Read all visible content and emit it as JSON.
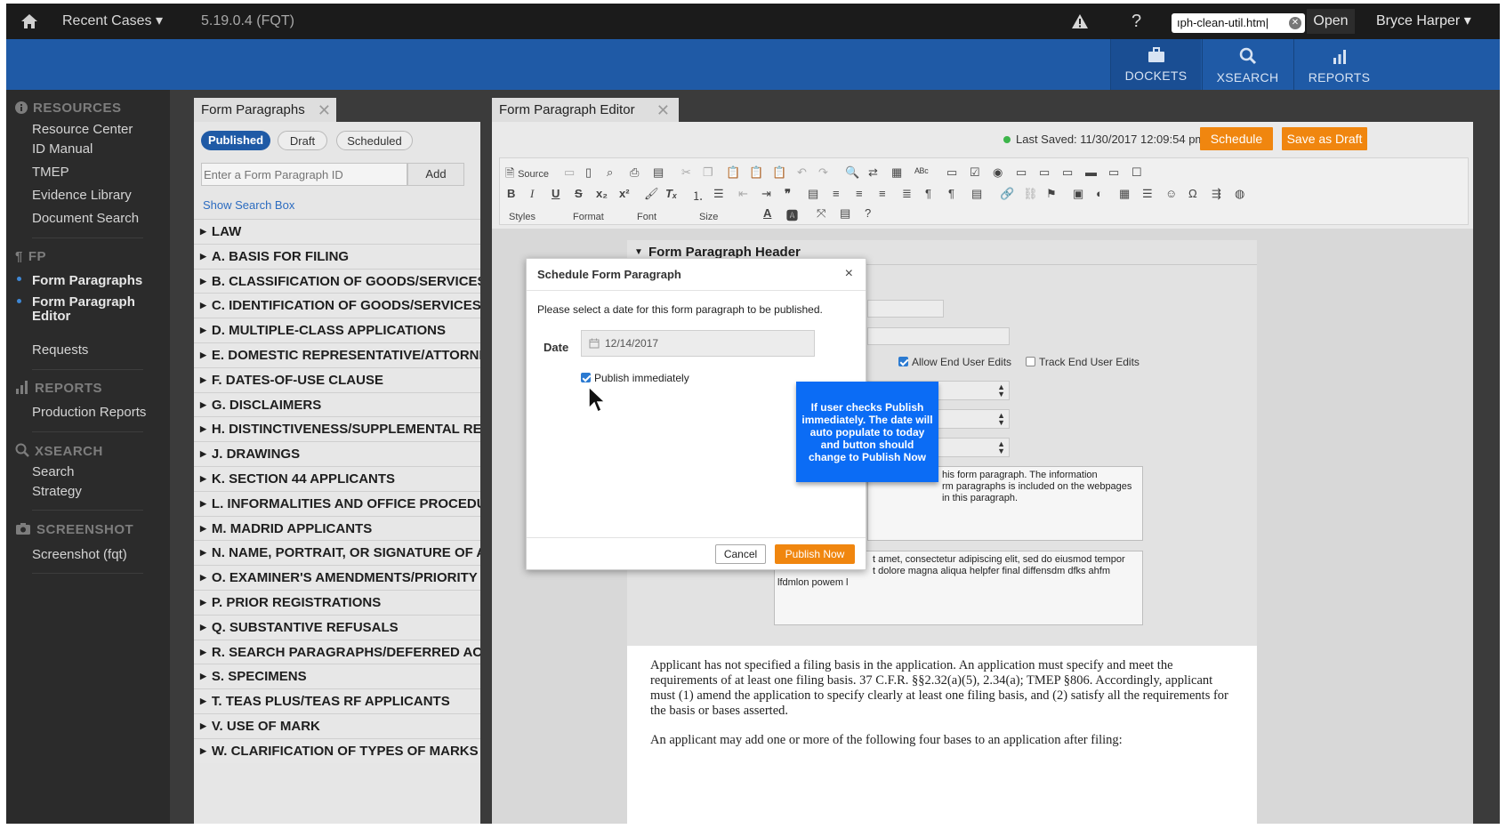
{
  "topbar": {
    "recent_cases": "Recent Cases ▾",
    "version": "5.19.0.4 (FQT)",
    "help": "?",
    "url_value": "ıph-clean-util.htm|",
    "open": "Open",
    "user": "Bryce Harper ▾"
  },
  "nav": [
    {
      "label": "DOCKETS",
      "icon": "briefcase-icon"
    },
    {
      "label": "XSEARCH",
      "icon": "search-icon"
    },
    {
      "label": "REPORTS",
      "icon": "bar-chart-icon"
    }
  ],
  "sidebar": {
    "resources": {
      "title": "RESOURCES",
      "items": [
        "Resource Center",
        "ID Manual",
        "TMEP",
        "Evidence Library",
        "Document Search"
      ]
    },
    "fp": {
      "title": "FP",
      "items": [
        "Form Paragraphs",
        "Form Paragraph Editor",
        "Requests"
      ]
    },
    "reports": {
      "title": "REPORTS",
      "items": [
        "Production Reports"
      ]
    },
    "xsearch": {
      "title": "XSEARCH",
      "items": [
        "Search",
        "Strategy"
      ]
    },
    "screenshot": {
      "title": "SCREENSHOT",
      "items": [
        "Screenshot (fqt)"
      ]
    }
  },
  "form_paragraphs": {
    "tab": "Form Paragraphs",
    "pills": [
      "Published",
      "Draft",
      "Scheduled"
    ],
    "id_placeholder": "Enter a Form Paragraph ID",
    "add": "Add",
    "show_search": "Show Search Box",
    "sections": [
      "LAW",
      "A. BASIS FOR FILING",
      "B. CLASSIFICATION OF GOODS/SERVICES",
      "C. IDENTIFICATION OF GOODS/SERVICES",
      "D. MULTIPLE-CLASS APPLICATIONS",
      "E. DOMESTIC REPRESENTATIVE/ATTORNEY",
      "F. DATES-OF-USE CLAUSE",
      "G. DISCLAIMERS",
      "H. DISTINCTIVENESS/SUPPLEMENTAL RE",
      "J. DRAWINGS",
      "K. SECTION 44 APPLICANTS",
      "L. INFORMALITIES AND OFFICE PROCEDU",
      "M. MADRID APPLICANTS",
      "N. NAME, PORTRAIT, OR SIGNATURE OF A",
      "O. EXAMINER'S AMENDMENTS/PRIORITY",
      "P. PRIOR REGISTRATIONS",
      "Q. SUBSTANTIVE REFUSALS",
      "R. SEARCH PARAGRAPHS/DEFERRED AC",
      "S. SPECIMENS",
      "T. TEAS PLUS/TEAS RF APPLICANTS",
      "V. USE OF MARK",
      "W. CLARIFICATION OF TYPES OF MARKS"
    ]
  },
  "editor": {
    "tab": "Form Paragraph Editor",
    "last_saved": "Last Saved: 11/30/2017 12:09:54 pm",
    "schedule": "Schedule",
    "save_draft": "Save as Draft",
    "toolbar": {
      "source": "Source",
      "styles": "Styles",
      "format": "Format",
      "font": "Font",
      "size": "Size"
    },
    "header": "Form Paragraph Header",
    "allow_end_user": "Allow End User Edits",
    "track_end_user": "Track End User Edits",
    "ta1_line1": "his form paragraph.  The information",
    "ta1_line2": "rm paragraphs is included on the webpages in this paragraph.",
    "ta2_line1": "t amet, consectetur adipiscing elit, sed do eiusmod tempor",
    "ta2_line2": "t dolore magna aliqua helpfer final diffensdm dfks ahfm",
    "ta2_line3": "lfdmlon powem l",
    "legal_p1": "Applicant has not specified a filing basis in the application. An application must specify and meet the requirements of at least one filing basis. 37 C.F.R. §§2.32(a)(5), 2.34(a); TMEP §806. Accordingly, applicant must (1) amend the application to specify clearly at least one filing basis, and (2) satisfy all the requirements for the basis or bases asserted.",
    "legal_p2": "An applicant may add one or more of the following four bases to an application after filing:"
  },
  "modal": {
    "title": "Schedule Form Paragraph",
    "close": "×",
    "message": "Please select a date for this form paragraph to be published.",
    "date_label": "Date",
    "date_value": "12/14/2017",
    "publish_immediately": "Publish immediately",
    "cancel": "Cancel",
    "publish_now": "Publish Now"
  },
  "callout": "If user checks Publish immediately. The date will auto populate to today and button should change to Publish Now",
  "colors": {
    "brand_blue": "#1f5aa6",
    "accent_orange": "#f0860f",
    "callout_blue": "#0b6cf5"
  }
}
